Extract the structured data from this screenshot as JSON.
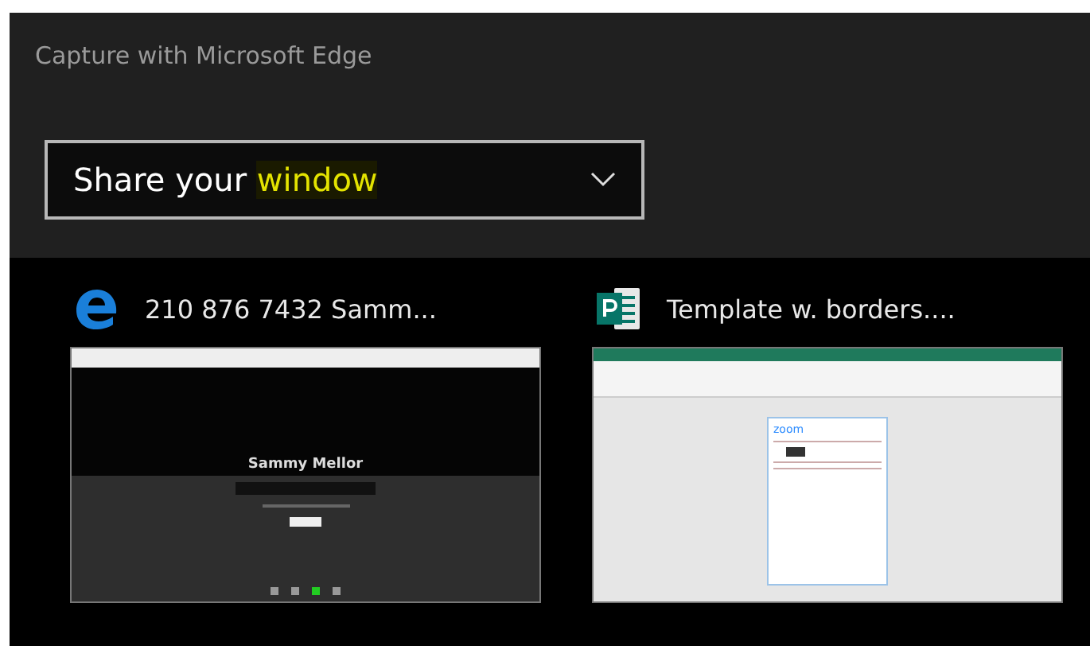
{
  "header": {
    "title": "Capture with Microsoft Edge"
  },
  "dropdown": {
    "text": "Share your ",
    "highlight": "window"
  },
  "windows": [
    {
      "kind": "edge",
      "title": "210 876 7432 Samm...",
      "preview": {
        "kind": "call",
        "caption": "Sammy Mellor"
      }
    },
    {
      "kind": "publisher",
      "title": "Template w. borders....",
      "preview": {
        "kind": "document",
        "logo": "zoom"
      }
    }
  ]
}
